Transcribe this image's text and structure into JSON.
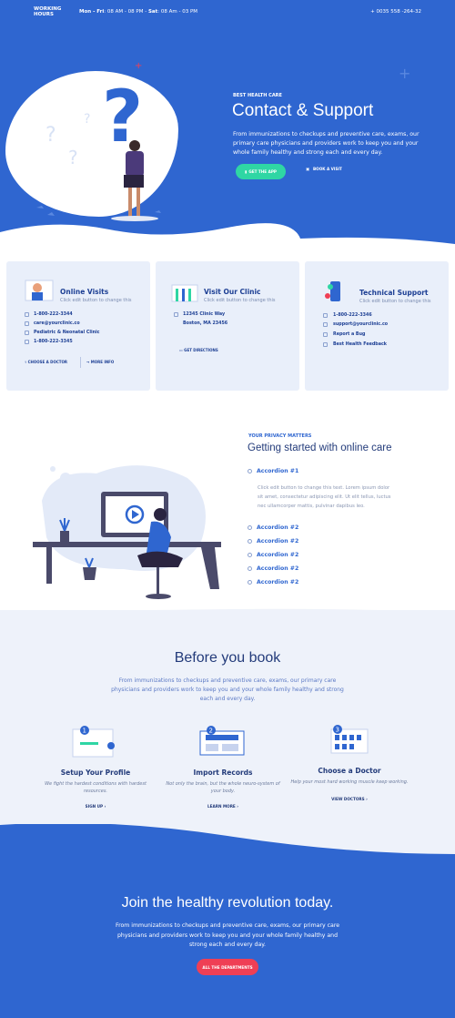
{
  "topbar": {
    "working_hours": "WORKING HOURS",
    "weekday_label": "Mon - Fri",
    "weekday_hours": ": 08 AM - 08 PM -",
    "sat_label": "Sat",
    "sat_hours": ": 08 Am - 03 PM",
    "phone": "+ 0035 558 -264-32"
  },
  "hero": {
    "eyebrow": "BEST HEALTH CARE",
    "title": "Contact & Support",
    "description": "From immunizations to checkups and  preventive care,  exams, our primary care physicians and providers work to keep you and your whole family healthy and strong each and every day.",
    "btn_app": "GET THE APP",
    "btn_visit": "BOOK A VISIT"
  },
  "cards": [
    {
      "title": "Online Visits",
      "subtitle": "Click edit button to change this",
      "items": [
        "1-800-222-3344",
        "care@yourclinic.co",
        "Pediatric & Neonatal Clinic",
        "1-800-222-3345"
      ],
      "link1": "CHOOSE A DOCTOR",
      "link2": "MORE INFO"
    },
    {
      "title": "Visit Our Clinic",
      "subtitle": "Click edit button to change this",
      "items": [
        "12345 Clinic Way",
        "Boston, MA 23456"
      ],
      "link1": "GET DIRECTIONS"
    },
    {
      "title": "Technical Support",
      "subtitle": "Click edit button to change this",
      "items": [
        "1-800-222-3346",
        "support@yourclinic.co",
        "Report a Bug",
        "Best Health Feedback"
      ]
    }
  ],
  "privacy": {
    "eyebrow": "YOUR PRIVACY MATTERS",
    "title": "Getting started with online care",
    "accordion_open": "Accordion #1",
    "accordion_body": "Click edit button to change this text. Lorem ipsum dolor sit amet, consectetur adipiscing elit. Ut elit tellus, luctus nec ullamcorper mattis, pulvinar dapibus leo.",
    "accordion_closed": [
      "Accordion #2",
      "Accordion #2",
      "Accordion #2",
      "Accordion #2",
      "Accordion #2"
    ]
  },
  "book": {
    "title": "Before you book",
    "description": "From immunizations to checkups and  preventive care,  exams, our primary care physicians and providers work to keep you and your whole family healthy and strong each and every day.",
    "steps": [
      {
        "num": "1",
        "title": "Setup Your Profile",
        "desc": "We fight the hardest conditions with hardest resources.",
        "link": "SIGN UP ›"
      },
      {
        "num": "2",
        "title": "Import Records",
        "desc": "Not only the brain, but the whole neuro-system of your body.",
        "link": "LEARN MORE ›"
      },
      {
        "num": "3",
        "title": "Choose a Doctor",
        "desc": "Help your most hard working muscle keep working.",
        "link": "VIEW DOCTORS ›"
      }
    ]
  },
  "footer": {
    "title": "Join the healthy revolution today.",
    "description": "From immunizations to checkups and  preventive care,  exams, our primary care physicians and providers work to keep you and your whole family healthy and strong each and every day.",
    "button": "ALL THE DEPARTMENTS"
  },
  "colors": {
    "primary": "#2f66d0",
    "accent_green": "#2fd6a4",
    "accent_red": "#ef3f55",
    "navy": "#233b7a",
    "light": "#e9effa"
  }
}
